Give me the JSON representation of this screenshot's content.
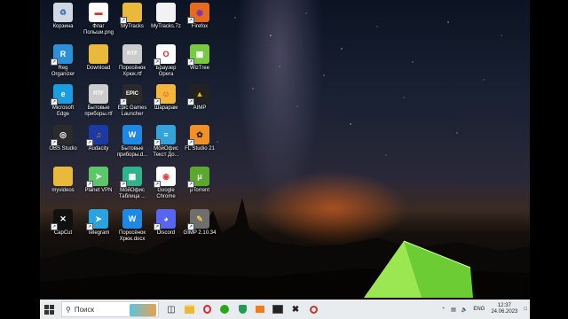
{
  "desktop_icons": [
    {
      "label": "Корзина",
      "icon": "recycle-bin-icon"
    },
    {
      "label": "Флаг\nПольши.png",
      "icon": "image-file-icon"
    },
    {
      "label": "MyTracks",
      "icon": "folder-icon"
    },
    {
      "label": "MyTracks.7z",
      "icon": "archive-file-icon"
    },
    {
      "label": "Firefox",
      "icon": "firefox-icon"
    },
    {
      "label": "Reg\nOrganizer",
      "icon": "reg-organizer-icon"
    },
    {
      "label": "Download",
      "icon": "folder-icon"
    },
    {
      "label": "Поросёнок\nХрюк.rtf",
      "icon": "rtf-file-icon"
    },
    {
      "label": "Браузер\nOpera",
      "icon": "opera-icon"
    },
    {
      "label": "WizTree",
      "icon": "wiztree-icon"
    },
    {
      "label": "Microsoft\nEdge",
      "icon": "edge-icon"
    },
    {
      "label": "Бытовые\nприборы.rtf",
      "icon": "rtf-file-icon"
    },
    {
      "label": "Epic Games\nLauncher",
      "icon": "epic-games-icon"
    },
    {
      "label": "Шарарам",
      "icon": "shararam-icon"
    },
    {
      "label": "AIMP",
      "icon": "aimp-icon"
    },
    {
      "label": "OBS Studio",
      "icon": "obs-icon"
    },
    {
      "label": "Audacity",
      "icon": "audacity-icon"
    },
    {
      "label": "Бытовые\nприборы.d...",
      "icon": "word-doc-icon"
    },
    {
      "label": "МойОфис\nТекст До...",
      "icon": "myoffice-text-icon"
    },
    {
      "label": "FL Studio 21",
      "icon": "fl-studio-icon"
    },
    {
      "label": "myvideos",
      "icon": "folder-icon"
    },
    {
      "label": "Planet VPN",
      "icon": "planet-vpn-icon"
    },
    {
      "label": "МойОфис\nТаблица ...",
      "icon": "myoffice-table-icon"
    },
    {
      "label": "Google\nChrome",
      "icon": "chrome-icon"
    },
    {
      "label": "μTorrent",
      "icon": "utorrent-icon"
    },
    {
      "label": "CapCut",
      "icon": "capcut-icon"
    },
    {
      "label": "Telegram",
      "icon": "telegram-icon"
    },
    {
      "label": "Поросёнок\nХрюк.docx",
      "icon": "word-doc-icon"
    },
    {
      "label": "Discord",
      "icon": "discord-icon"
    },
    {
      "label": "GIMP 2.10.34",
      "icon": "gimp-icon"
    }
  ],
  "taskbar": {
    "search_label": "Поиск",
    "pinned": [
      "start-icon",
      "task-view-icon",
      "file-explorer-icon",
      "opera-icon",
      "whatsapp-icon",
      "shield-icon",
      "mail-icon",
      "capcut-icon",
      "clock-app-icon"
    ],
    "tray": {
      "language": "ENG",
      "time": "12:37",
      "date": "24.06.2023"
    }
  },
  "colors": {
    "taskbar_bg": "#e9ecef",
    "tent_green": "#7cd63a"
  }
}
